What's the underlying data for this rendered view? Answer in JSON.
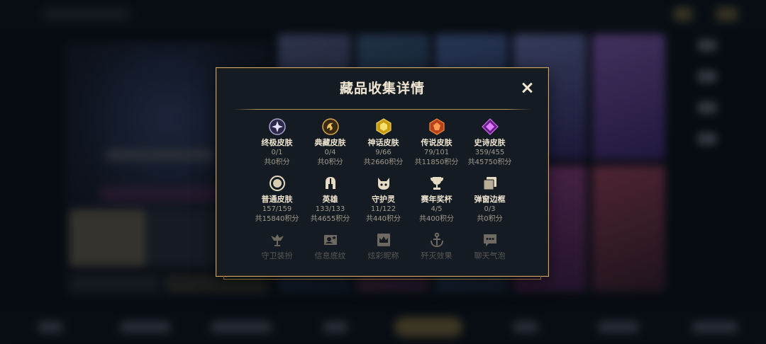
{
  "modal": {
    "title": "藏品收集详情"
  },
  "collections": [
    {
      "name": "终极皮肤",
      "count": "0/1",
      "score": "共0积分",
      "icon": "ultimate-gem-icon"
    },
    {
      "name": "典藏皮肤",
      "count": "0/4",
      "score": "共0积分",
      "icon": "dragon-emblem-icon"
    },
    {
      "name": "神话皮肤",
      "count": "9/66",
      "score": "共2660积分",
      "icon": "mythic-gem-icon"
    },
    {
      "name": "传说皮肤",
      "count": "79/101",
      "score": "共11850积分",
      "icon": "legendary-gem-icon"
    },
    {
      "name": "史诗皮肤",
      "count": "359/455",
      "score": "共45750积分",
      "icon": "epic-gem-icon"
    },
    {
      "name": "普通皮肤",
      "count": "157/159",
      "score": "共15840积分",
      "icon": "common-circle-icon"
    },
    {
      "name": "英雄",
      "count": "133/133",
      "score": "共4655积分",
      "icon": "helmet-icon"
    },
    {
      "name": "守护灵",
      "count": "11/122",
      "score": "共440积分",
      "icon": "little-legend-icon"
    },
    {
      "name": "赛年奖杯",
      "count": "4/5",
      "score": "共400积分",
      "icon": "trophy-icon"
    },
    {
      "name": "弹窗边框",
      "count": "0/3",
      "score": "共0积分",
      "icon": "frame-stack-icon"
    },
    {
      "name": "守卫装扮",
      "count": "",
      "score": "",
      "icon": "ward-icon"
    },
    {
      "name": "信息底纹",
      "count": "",
      "score": "",
      "icon": "profile-banner-icon"
    },
    {
      "name": "炫彩昵称",
      "count": "",
      "score": "",
      "icon": "crown-card-icon"
    },
    {
      "name": "歼灭效果",
      "count": "",
      "score": "",
      "icon": "anchor-icon"
    },
    {
      "name": "聊天气泡",
      "count": "",
      "score": "",
      "icon": "chat-bubble-icon"
    }
  ],
  "colors": {
    "gold": "#c4a46a",
    "title": "#f0e6d2",
    "muted": "#a09b8c",
    "panel": "#141b22"
  }
}
